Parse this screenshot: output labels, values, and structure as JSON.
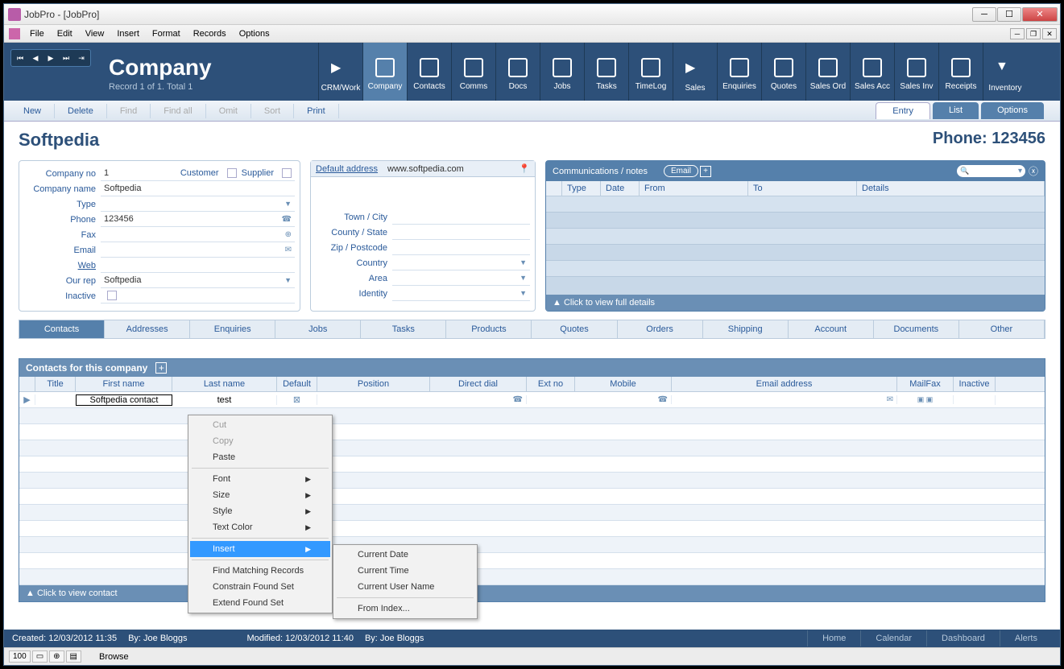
{
  "window": {
    "title": "JobPro - [JobPro]"
  },
  "menubar": [
    "File",
    "Edit",
    "View",
    "Insert",
    "Format",
    "Records",
    "Options"
  ],
  "toolbar": {
    "title": "Company",
    "record_info": "Record 1 of 1. Total 1",
    "items": [
      "CRM/Work",
      "Company",
      "Contacts",
      "Comms",
      "Docs",
      "Jobs",
      "Tasks",
      "TimeLog",
      "Sales",
      "Enquiries",
      "Quotes",
      "Sales Ord",
      "Sales Acc",
      "Sales Inv",
      "Receipts",
      "Inventory"
    ]
  },
  "actions": {
    "new": "New",
    "delete": "Delete",
    "find": "Find",
    "findall": "Find all",
    "omit": "Omit",
    "sort": "Sort",
    "print": "Print"
  },
  "actiontabs": {
    "entry": "Entry",
    "list": "List",
    "options": "Options"
  },
  "header": {
    "company": "Softpedia",
    "phone": "Phone: 123456"
  },
  "company_panel": {
    "company_no_lbl": "Company no",
    "company_no": "1",
    "customer_lbl": "Customer",
    "supplier_lbl": "Supplier",
    "company_name_lbl": "Company name",
    "company_name": "Softpedia",
    "type_lbl": "Type",
    "phone_lbl": "Phone",
    "phone": "123456",
    "fax_lbl": "Fax",
    "email_lbl": "Email",
    "web_lbl": "Web",
    "ourrep_lbl": "Our rep",
    "ourrep": "Softpedia",
    "inactive_lbl": "Inactive"
  },
  "address_panel": {
    "default_lbl": "Default address",
    "default": "www.softpedia.com",
    "town_lbl": "Town / City",
    "county_lbl": "County / State",
    "zip_lbl": "Zip / Postcode",
    "country_lbl": "Country",
    "area_lbl": "Area",
    "identity_lbl": "Identity"
  },
  "comm_panel": {
    "title": "Communications / notes",
    "badge": "Email",
    "cols": {
      "type": "Type",
      "date": "Date",
      "from": "From",
      "to": "To",
      "details": "Details"
    },
    "footer": "▲  Click to view full details"
  },
  "subtabs": [
    "Contacts",
    "Addresses",
    "Enquiries",
    "Jobs",
    "Tasks",
    "Products",
    "Quotes",
    "Orders",
    "Shipping",
    "Account",
    "Documents",
    "Other"
  ],
  "contacts": {
    "title": "Contacts for this company",
    "cols": {
      "title": "Title",
      "fname": "First name",
      "lname": "Last name",
      "def": "Default",
      "pos": "Position",
      "dial": "Direct dial",
      "ext": "Ext no",
      "mob": "Mobile",
      "email": "Email address",
      "mf": "MailFax",
      "inac": "Inactive"
    },
    "row": {
      "fname": "Softpedia contact",
      "lname": "test"
    },
    "footer": "▲  Click to view contact"
  },
  "context": {
    "cut": "Cut",
    "copy": "Copy",
    "paste": "Paste",
    "font": "Font",
    "size": "Size",
    "style": "Style",
    "textcolor": "Text Color",
    "insert": "Insert",
    "findm": "Find Matching Records",
    "constrain": "Constrain Found Set",
    "extend": "Extend Found Set"
  },
  "submenu": {
    "date": "Current Date",
    "time": "Current Time",
    "user": "Current User Name",
    "index": "From Index..."
  },
  "status": {
    "created": "Created:  12/03/2012   11:35",
    "by1": "By:  Joe Bloggs",
    "modified": "Modified:  12/03/2012   11:40",
    "by2": "By:  Joe Bloggs",
    "home": "Home",
    "calendar": "Calendar",
    "dashboard": "Dashboard",
    "alerts": "Alerts"
  },
  "bottom": {
    "zoom": "100",
    "mode": "Browse"
  }
}
